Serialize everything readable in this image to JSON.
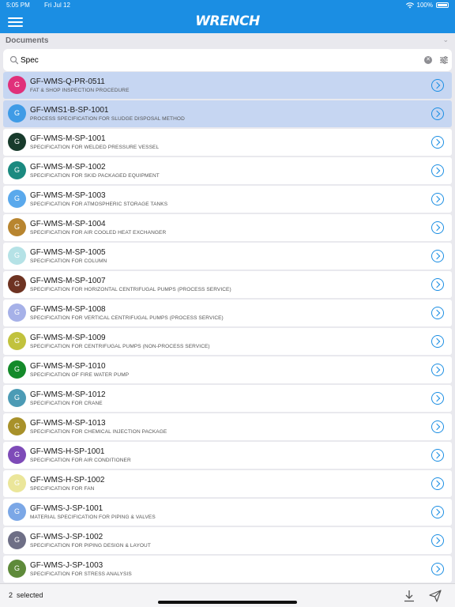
{
  "status": {
    "time": "5:05 PM",
    "date": "Fri Jul 12",
    "battery": "100%"
  },
  "app": {
    "title": "WRENCH"
  },
  "section": {
    "title": "Documents"
  },
  "search": {
    "value": "Spec"
  },
  "footer": {
    "selected_count": "2",
    "selected_label": "selected"
  },
  "avatar_letter": "G",
  "rows": [
    {
      "code": "GF-WMS-Q-PR-0511",
      "desc": "FAT & SHOP INSPECTION PROCEDURE",
      "color": "#e0307a",
      "selected": true
    },
    {
      "code": "GF-WMS1-B-SP-1001",
      "desc": "PROCESS SPECIFICATION FOR SLUDGE DISPOSAL METHOD",
      "color": "#3f9be6",
      "selected": true
    },
    {
      "code": "GF-WMS-M-SP-1001",
      "desc": "SPECIFICATION FOR WELDED PRESSURE VESSEL",
      "color": "#183b2c",
      "selected": false
    },
    {
      "code": "GF-WMS-M-SP-1002",
      "desc": "SPECIFICATION FOR SKID PACKAGED EQUIPMENT",
      "color": "#1b8a80",
      "selected": false
    },
    {
      "code": "GF-WMS-M-SP-1003",
      "desc": "SPECIFICATION FOR ATMOSPHERIC STORAGE TANKS",
      "color": "#5aa9ec",
      "selected": false
    },
    {
      "code": "GF-WMS-M-SP-1004",
      "desc": "SPECIFICATION FOR AIR COOLED HEAT EXCHANGER",
      "color": "#b8852f",
      "selected": false
    },
    {
      "code": "GF-WMS-M-SP-1005",
      "desc": "SPECIFICATION FOR COLUMN",
      "color": "#b5e2e6",
      "selected": false
    },
    {
      "code": "GF-WMS-M-SP-1007",
      "desc": "SPECIFICATION FOR HORIZONTAL CENTRIFUGAL PUMPS (PROCESS SERVICE)",
      "color": "#6e3322",
      "selected": false
    },
    {
      "code": "GF-WMS-M-SP-1008",
      "desc": "SPECIFICATION FOR VERTICAL CENTRIFUGAL PUMPS (PROCESS SERVICE)",
      "color": "#a6b1e8",
      "selected": false
    },
    {
      "code": "GF-WMS-M-SP-1009",
      "desc": "SPECIFICATION FOR CENTRIFUGAL PUMPS (NON-PROCESS SERVICE)",
      "color": "#c1c23d",
      "selected": false
    },
    {
      "code": "GF-WMS-M-SP-1010",
      "desc": "SPECIFICATION OF FIRE WATER PUMP",
      "color": "#148a2a",
      "selected": false
    },
    {
      "code": "GF-WMS-M-SP-1012",
      "desc": "SPECIFICATION FOR CRANE",
      "color": "#4c9bb5",
      "selected": false
    },
    {
      "code": "GF-WMS-M-SP-1013",
      "desc": "SPECIFICATION FOR CHEMICAL INJECTION PACKAGE",
      "color": "#a8912a",
      "selected": false
    },
    {
      "code": "GF-WMS-H-SP-1001",
      "desc": "SPECIFICATION FOR AIR CONDITIONER",
      "color": "#7e4bb8",
      "selected": false
    },
    {
      "code": "GF-WMS-H-SP-1002",
      "desc": "SPECIFICATION FOR FAN",
      "color": "#ebe69a",
      "selected": false
    },
    {
      "code": "GF-WMS-J-SP-1001",
      "desc": "MATERIAL SPECIFICATION FOR PIPING & VALVES",
      "color": "#7ba7e6",
      "selected": false
    },
    {
      "code": "GF-WMS-J-SP-1002",
      "desc": "SPECIFICATION FOR PIPING DESIGN & LAYOUT",
      "color": "#6e6f86",
      "selected": false
    },
    {
      "code": "GF-WMS-J-SP-1003",
      "desc": "SPECIFICATION FOR STRESS ANALYSIS",
      "color": "#5e8a3a",
      "selected": false
    }
  ]
}
